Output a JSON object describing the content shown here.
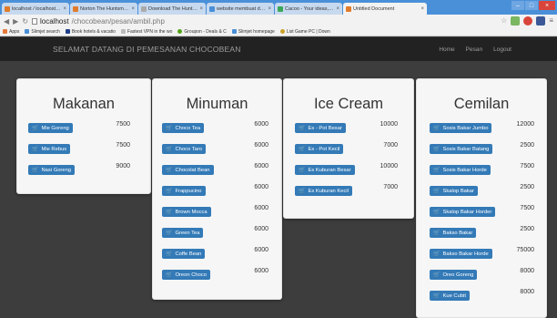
{
  "browser": {
    "tabs": [
      {
        "label": "localhost / localhost / cho",
        "active": false
      },
      {
        "label": "Norton The Huntsman 2",
        "active": false
      },
      {
        "label": "Download The Huntsman",
        "active": false
      },
      {
        "label": "website membuat dfd en",
        "active": false
      },
      {
        "label": "Cacoo - Your ideas, Our",
        "active": false
      },
      {
        "label": "Untitled Document",
        "active": true
      }
    ],
    "url_host": "localhost",
    "url_path": "/chocobean/pesan/ambil.php",
    "bookmarks": [
      "Apps",
      "Slimjet search",
      "Book hotels & vacatio",
      "Fastest VPN in the wo",
      "Groupon - Deals & C",
      "Slimjet homepage",
      "List Game PC | Down"
    ]
  },
  "navbar": {
    "brand": "SELAMAT DATANG DI PEMESANAN CHOCOBEAN",
    "links": [
      "Home",
      "Pesan",
      "Logout"
    ]
  },
  "cards": {
    "makanan": {
      "title": "Makanan",
      "items": [
        {
          "name": "Mie Goreng",
          "price": "7500"
        },
        {
          "name": "Mie Rebus",
          "price": "7500"
        },
        {
          "name": "Nasi Goreng",
          "price": "9000"
        }
      ]
    },
    "minuman": {
      "title": "Minuman",
      "items": [
        {
          "name": "Choco Tea",
          "price": "6000"
        },
        {
          "name": "Choco Taro",
          "price": "6000"
        },
        {
          "name": "Chocolat Bean",
          "price": "6000"
        },
        {
          "name": "Frappucino",
          "price": "6000"
        },
        {
          "name": "Brown Mocca",
          "price": "6000"
        },
        {
          "name": "Green Tea",
          "price": "6000"
        },
        {
          "name": "Coffe Bean",
          "price": "6000"
        },
        {
          "name": "Oreon Choco",
          "price": "6000"
        }
      ]
    },
    "icecream": {
      "title": "Ice Cream",
      "items": [
        {
          "name": "Es - Pot Besar",
          "price": "10000"
        },
        {
          "name": "Es - Pot Kecil",
          "price": "7000"
        },
        {
          "name": "Es Kuburan Besar",
          "price": "10000"
        },
        {
          "name": "Es Kuburan Kecil",
          "price": "7000"
        }
      ]
    },
    "cemilan": {
      "title": "Cemilan",
      "items": [
        {
          "name": "Sosis Bakar Jumbo",
          "price": "12000"
        },
        {
          "name": "Sosis Bakar Batang",
          "price": "2500"
        },
        {
          "name": "Sosis Bakar Horde",
          "price": "7500"
        },
        {
          "name": "Skalop Bakar",
          "price": "2500"
        },
        {
          "name": "Skalop Bakar Horder",
          "price": "7500"
        },
        {
          "name": "Bakso Bakar",
          "price": "2500"
        },
        {
          "name": "Bakso Bakar Horde",
          "price": "75000"
        },
        {
          "name": "Oreo Goreng",
          "price": "8000"
        },
        {
          "name": "Kue Cubit",
          "price": "8000"
        }
      ]
    }
  },
  "icons": {
    "order_button": "shopping-cart-icon"
  },
  "colors": {
    "navbar_bg": "#222222",
    "button_primary": "#337ab7",
    "page_bg": "#3d3d3d",
    "card_bg": "#f6f6f6"
  }
}
